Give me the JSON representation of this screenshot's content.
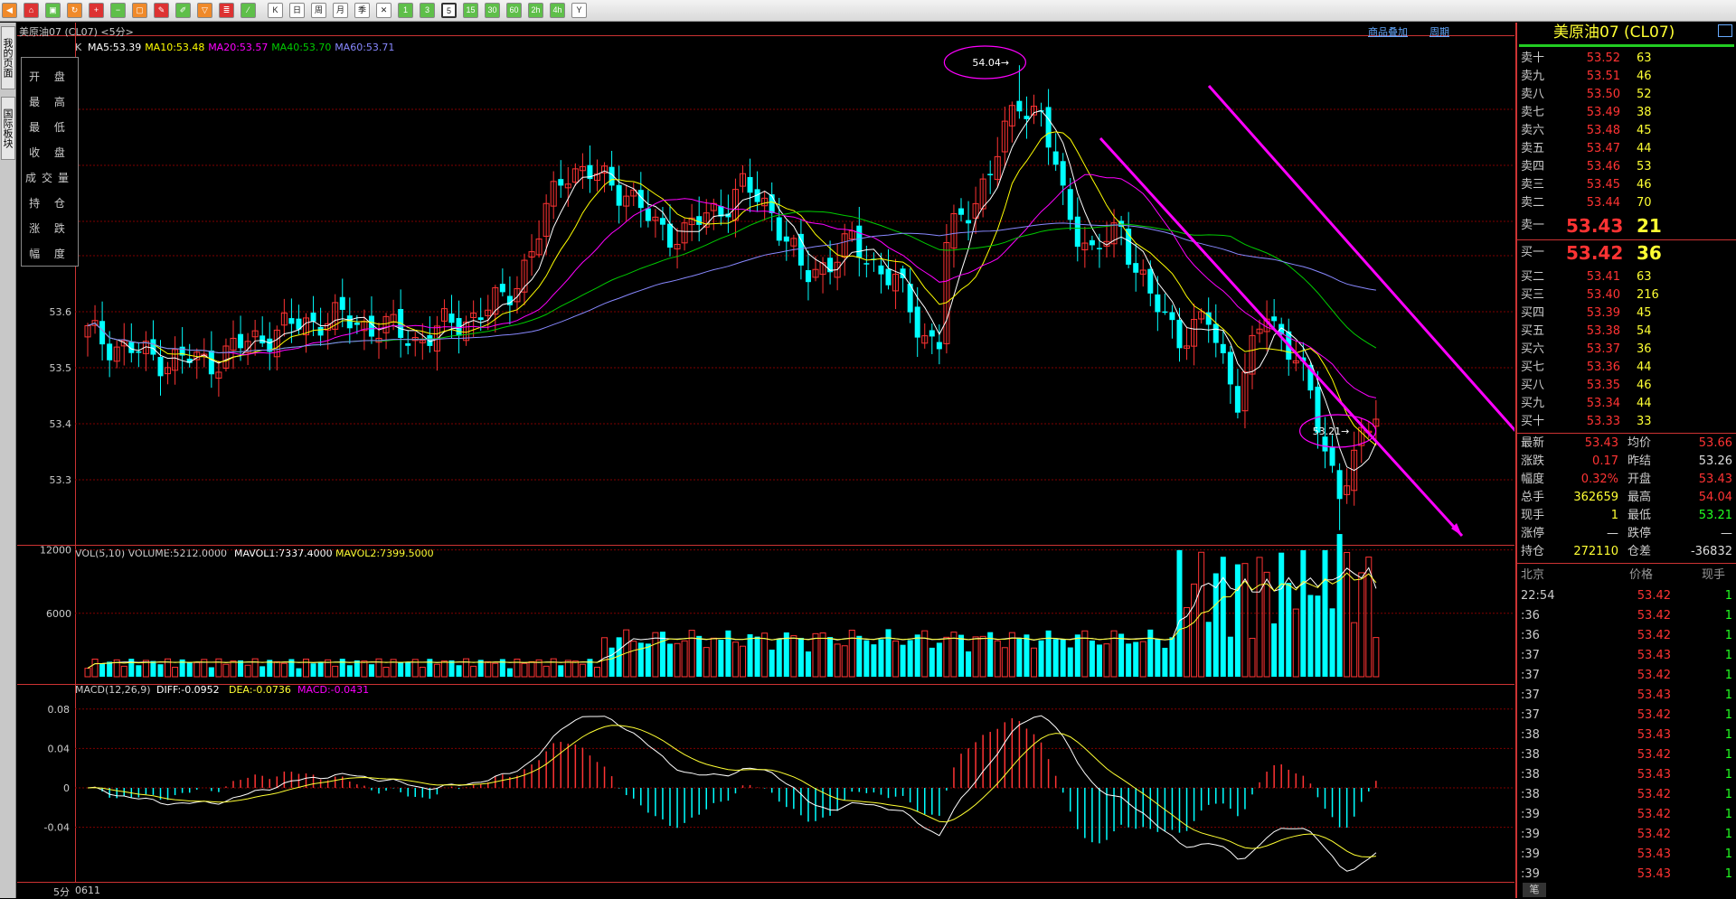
{
  "toolbar": {
    "buttons": [
      {
        "name": "back-icon",
        "glyph": "◀"
      },
      {
        "name": "home-icon",
        "glyph": "⌂"
      },
      {
        "name": "folder-icon",
        "glyph": "▣"
      },
      {
        "name": "refresh-icon",
        "glyph": "↻"
      },
      {
        "name": "zoom-in-icon",
        "glyph": "+"
      },
      {
        "name": "zoom-out-icon",
        "glyph": "−"
      },
      {
        "name": "window-icon",
        "glyph": "▢"
      },
      {
        "name": "draw-pen-icon",
        "glyph": "✎"
      },
      {
        "name": "draw-tool-icon",
        "glyph": "✐"
      },
      {
        "name": "filter-icon",
        "glyph": "▽"
      },
      {
        "name": "table-icon",
        "glyph": "≣"
      },
      {
        "name": "chart-line-icon",
        "glyph": "⁄"
      },
      {
        "name": "kline-icon",
        "glyph": "K"
      },
      {
        "name": "period-day",
        "glyph": "日"
      },
      {
        "name": "period-week",
        "glyph": "周"
      },
      {
        "name": "period-month",
        "glyph": "月"
      },
      {
        "name": "period-quarter",
        "glyph": "季"
      },
      {
        "name": "period-multi",
        "glyph": "✕"
      },
      {
        "name": "period-1m",
        "glyph": "1"
      },
      {
        "name": "period-3m",
        "glyph": "3"
      },
      {
        "name": "period-5m",
        "glyph": "5"
      },
      {
        "name": "period-15m",
        "glyph": "15"
      },
      {
        "name": "period-30m",
        "glyph": "30"
      },
      {
        "name": "period-60m",
        "glyph": "60"
      },
      {
        "name": "period-2h",
        "glyph": "2h"
      },
      {
        "name": "period-4h",
        "glyph": "4h"
      },
      {
        "name": "period-year",
        "glyph": "Y"
      }
    ]
  },
  "left_tabs": {
    "my_page": "我的页面",
    "intl_board": "国际板块"
  },
  "header": {
    "title": "美原油07 (CL07) <5分>",
    "link_overlay": "商品叠加",
    "link_period": "周期",
    "ma_line": {
      "k": "K",
      "ma5": "MA5:53.39",
      "ma10": "MA10:53.48",
      "ma20": "MA20:53.57",
      "ma40": "MA40:53.70",
      "ma60": "MA60:53.71"
    }
  },
  "stock_box": [
    "开 盘",
    "最 高",
    "最 低",
    "收 盘",
    "成交量",
    "持 仓",
    "涨 跌",
    "幅 度"
  ],
  "colors": {
    "up": "#ff3333",
    "down": "#00ffff",
    "ma5": "#ffffff",
    "ma10": "#ffff00",
    "ma20": "#ff00ff",
    "ma40": "#00cc00",
    "ma60": "#8888ff",
    "grid": "#800000",
    "arrow": "#ff00ff"
  },
  "price_axis": {
    "labels": [
      "53.6",
      "53.5",
      "53.4",
      "53.3"
    ]
  },
  "annotations": {
    "high": "54.04→",
    "low": "53.21→"
  },
  "volume": {
    "header": "VOL(5,10) VOLUME:5212.0000 MAVOL1:7337.4000 MAVOL2:7399.5000",
    "labels": [
      "12000",
      "6000"
    ]
  },
  "macd": {
    "header_name": "MACD(12,26,9)",
    "diff": "DIFF:-0.0952",
    "dea": "DEA:-0.0736",
    "macd": "MACD:-0.0431",
    "labels": [
      "0.08",
      "0.04",
      "0",
      "-0.04"
    ]
  },
  "status": {
    "period": "5分",
    "date": "0611"
  },
  "quote": {
    "title": "美原油07 (CL07)",
    "asks": [
      {
        "label": "卖十",
        "price": "53.52",
        "vol": "63"
      },
      {
        "label": "卖九",
        "price": "53.51",
        "vol": "46"
      },
      {
        "label": "卖八",
        "price": "53.50",
        "vol": "52"
      },
      {
        "label": "卖七",
        "price": "53.49",
        "vol": "38"
      },
      {
        "label": "卖六",
        "price": "53.48",
        "vol": "45"
      },
      {
        "label": "卖五",
        "price": "53.47",
        "vol": "44"
      },
      {
        "label": "卖四",
        "price": "53.46",
        "vol": "53"
      },
      {
        "label": "卖三",
        "price": "53.45",
        "vol": "46"
      },
      {
        "label": "卖二",
        "price": "53.44",
        "vol": "70"
      }
    ],
    "ask1": {
      "label": "卖一",
      "price": "53.43",
      "vol": "21"
    },
    "bid1": {
      "label": "买一",
      "price": "53.42",
      "vol": "36"
    },
    "bids": [
      {
        "label": "买二",
        "price": "53.41",
        "vol": "63"
      },
      {
        "label": "买三",
        "price": "53.40",
        "vol": "216"
      },
      {
        "label": "买四",
        "price": "53.39",
        "vol": "45"
      },
      {
        "label": "买五",
        "price": "53.38",
        "vol": "54"
      },
      {
        "label": "买六",
        "price": "53.37",
        "vol": "36"
      },
      {
        "label": "买七",
        "price": "53.36",
        "vol": "44"
      },
      {
        "label": "买八",
        "price": "53.35",
        "vol": "46"
      },
      {
        "label": "买九",
        "price": "53.34",
        "vol": "44"
      },
      {
        "label": "买十",
        "price": "53.33",
        "vol": "33"
      }
    ],
    "stats": [
      {
        "l1": "最新",
        "v1": "53.43",
        "c1": "red",
        "l2": "均价",
        "v2": "53.66",
        "c2": "red"
      },
      {
        "l1": "涨跌",
        "v1": "0.17",
        "c1": "red",
        "l2": "昨结",
        "v2": "53.26",
        "c2": "white"
      },
      {
        "l1": "幅度",
        "v1": "0.32%",
        "c1": "red",
        "l2": "开盘",
        "v2": "53.43",
        "c2": "red"
      },
      {
        "l1": "总手",
        "v1": "362659",
        "c1": "yellow",
        "l2": "最高",
        "v2": "54.04",
        "c2": "red"
      },
      {
        "l1": "现手",
        "v1": "1",
        "c1": "yellow",
        "l2": "最低",
        "v2": "53.21",
        "c2": "green"
      },
      {
        "l1": "涨停",
        "v1": "—",
        "c1": "white",
        "l2": "跌停",
        "v2": "—",
        "c2": "white"
      },
      {
        "l1": "持仓",
        "v1": "272110",
        "c1": "yellow",
        "l2": "仓差",
        "v2": "-36832",
        "c2": "white"
      }
    ],
    "tick_header": {
      "time": "北京",
      "price": "价格",
      "vol": "现手"
    },
    "ticks": [
      {
        "time": "22:54",
        "price": "53.42",
        "vol": "1"
      },
      {
        "time": ":36",
        "price": "53.42",
        "vol": "1"
      },
      {
        "time": ":36",
        "price": "53.42",
        "vol": "1"
      },
      {
        "time": ":37",
        "price": "53.43",
        "vol": "1"
      },
      {
        "time": ":37",
        "price": "53.42",
        "vol": "1"
      },
      {
        "time": ":37",
        "price": "53.43",
        "vol": "1"
      },
      {
        "time": ":37",
        "price": "53.42",
        "vol": "1"
      },
      {
        "time": ":38",
        "price": "53.43",
        "vol": "1"
      },
      {
        "time": ":38",
        "price": "53.42",
        "vol": "1"
      },
      {
        "time": ":38",
        "price": "53.43",
        "vol": "1"
      },
      {
        "time": ":38",
        "price": "53.42",
        "vol": "1"
      },
      {
        "time": ":39",
        "price": "53.42",
        "vol": "1"
      },
      {
        "time": ":39",
        "price": "53.42",
        "vol": "1"
      },
      {
        "time": ":39",
        "price": "53.43",
        "vol": "1"
      },
      {
        "time": ":39",
        "price": "53.43",
        "vol": "1"
      }
    ],
    "tab_bottom": "笔"
  }
}
